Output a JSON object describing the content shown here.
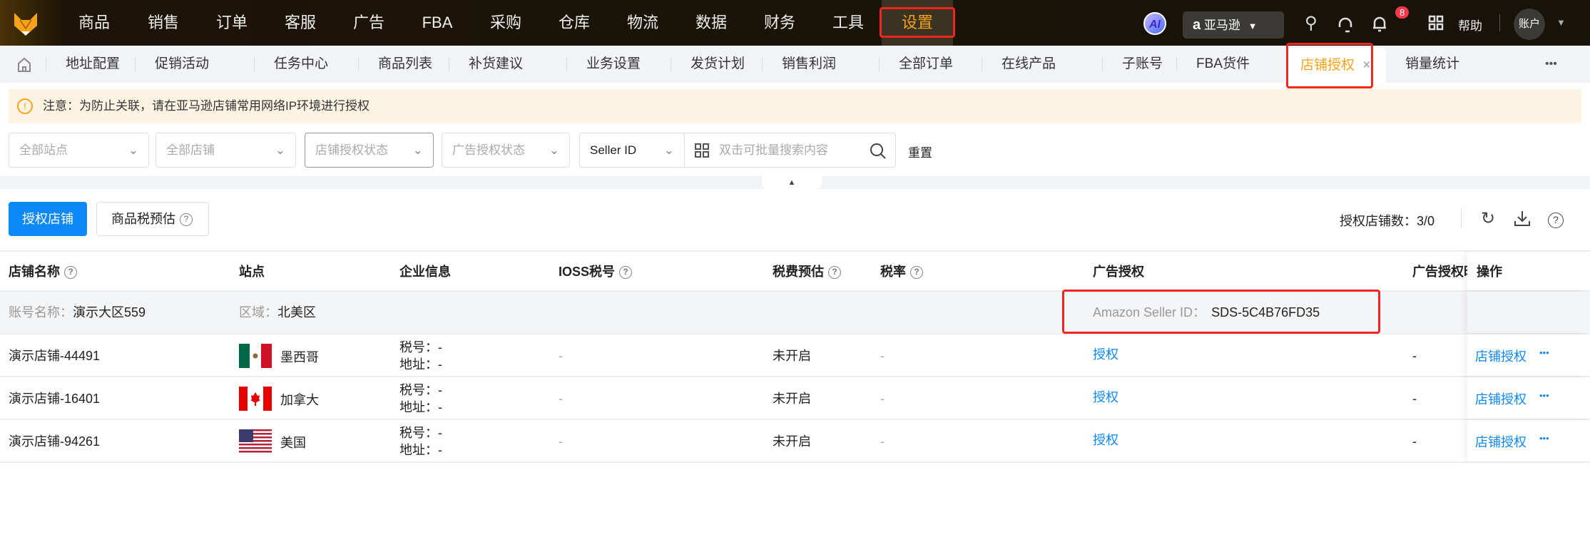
{
  "topnav": {
    "items": [
      "商品",
      "销售",
      "订单",
      "客服",
      "广告",
      "FBA",
      "采购",
      "仓库",
      "物流",
      "数据",
      "财务",
      "工具",
      "设置"
    ],
    "active": "设置",
    "ai": "AI",
    "marketplace": "亚马逊",
    "notifications": "8",
    "help": "帮助",
    "account": "账户"
  },
  "tabs": {
    "items": [
      "地址配置",
      "促销活动",
      "任务中心",
      "商品列表",
      "补货建议",
      "业务设置",
      "发货计划",
      "销售利润",
      "全部订单",
      "在线产品",
      "子账号",
      "FBA货件"
    ],
    "active": "店铺授权",
    "after": "销量统计",
    "more": "•••"
  },
  "notice": "注意：为防止关联，请在亚马逊店铺常用网络IP环境进行授权",
  "filters": {
    "site": "全部站点",
    "shop": "全部店铺",
    "shop_auth": "店铺授权状态",
    "ad_auth": "广告授权状态",
    "search_type": "Seller ID",
    "search_placeholder": "双击可批量搜索内容",
    "reset": "重置"
  },
  "actions": {
    "authorize": "授权店铺",
    "tax_estimate": "商品税预估",
    "count_label": "授权店铺数：",
    "count": "3/0"
  },
  "table": {
    "headers": [
      "店铺名称",
      "站点",
      "企业信息",
      "IOSS税号",
      "税费预估",
      "税率",
      "广告授权",
      "广告授权时",
      "操作"
    ],
    "group": {
      "account_label": "账号名称：",
      "account": "演示大区559",
      "region_label": "区域：",
      "region": "北美区",
      "seller_label": "Amazon Seller ID：",
      "seller_id": "SDS-5C4B76FD35"
    },
    "tax_label": "税号：",
    "addr_label": "地址：",
    "rows": [
      {
        "name": "演示店铺-44491",
        "site": "墨西哥",
        "flag": "mx",
        "tax": "-",
        "addr": "-",
        "ioss": "-",
        "estimate": "未开启",
        "rate": "-",
        "ad": "授权",
        "ad_time": "-",
        "op": "店铺授权",
        "more": "•••"
      },
      {
        "name": "演示店铺-16401",
        "site": "加拿大",
        "flag": "ca",
        "tax": "-",
        "addr": "-",
        "ioss": "-",
        "estimate": "未开启",
        "rate": "-",
        "ad": "授权",
        "ad_time": "-",
        "op": "店铺授权",
        "more": "•••"
      },
      {
        "name": "演示店铺-94261",
        "site": "美国",
        "flag": "us",
        "tax": "-",
        "addr": "-",
        "ioss": "-",
        "estimate": "未开启",
        "rate": "-",
        "ad": "授权",
        "ad_time": "-",
        "op": "店铺授权",
        "more": "•••"
      }
    ]
  },
  "colors": {
    "accent": "#f7a21b",
    "primary": "#0d88f7",
    "highlight": "#f0261f"
  }
}
